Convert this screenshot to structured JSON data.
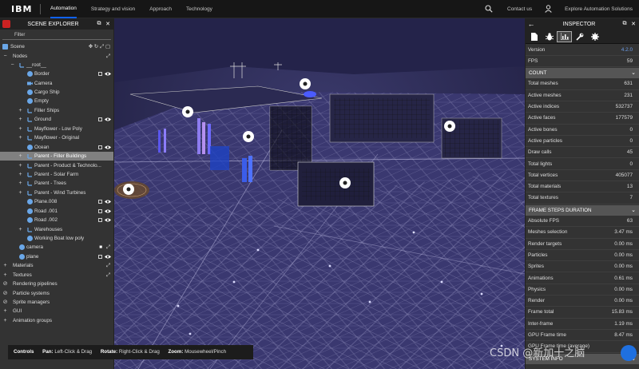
{
  "topnav": {
    "logo": "IBM",
    "links": [
      "Automation",
      "Strategy and vision",
      "Approach",
      "Technology"
    ],
    "active_link": "Automation",
    "contact": "Contact us",
    "solutions": "Explore Automation Solutions"
  },
  "explorer": {
    "title": "SCENE EXPLORER",
    "filter_placeholder": "Filter",
    "scene_label": "Scene",
    "nodes_label": "Nodes",
    "root_label": "__root__",
    "items": [
      {
        "label": "Border",
        "toggle": "",
        "box": true,
        "eye": true
      },
      {
        "label": "Camera",
        "toggle": "",
        "box": false,
        "eye": false
      },
      {
        "label": "Cargo Ship",
        "toggle": "",
        "box": false,
        "eye": false
      },
      {
        "label": "Empty",
        "toggle": "",
        "box": false,
        "eye": false
      },
      {
        "label": "Filler Ships",
        "toggle": "+",
        "box": false,
        "eye": false
      },
      {
        "label": "Ground",
        "toggle": "+",
        "box": true,
        "eye": true
      },
      {
        "label": "Mayflower - Low Poly",
        "toggle": "+",
        "box": false,
        "eye": false
      },
      {
        "label": "Mayflower - Original",
        "toggle": "+",
        "box": false,
        "eye": false
      },
      {
        "label": "Ocean",
        "toggle": "",
        "box": true,
        "eye": true
      },
      {
        "label": "Parent - Filler Buildings",
        "toggle": "+",
        "box": false,
        "eye": false,
        "selected": true
      },
      {
        "label": "Parent - Product & Technolo...",
        "toggle": "+",
        "box": false,
        "eye": false
      },
      {
        "label": "Parent - Solar Farm",
        "toggle": "+",
        "box": false,
        "eye": false
      },
      {
        "label": "Parent - Trees",
        "toggle": "+",
        "box": false,
        "eye": false
      },
      {
        "label": "Parent - Wind Turbines",
        "toggle": "+",
        "box": false,
        "eye": false
      },
      {
        "label": "Plane.008",
        "toggle": "",
        "box": true,
        "eye": true
      },
      {
        "label": "Road .001",
        "toggle": "",
        "box": true,
        "eye": true
      },
      {
        "label": "Road .002",
        "toggle": "",
        "box": true,
        "eye": true
      },
      {
        "label": "Warehouses",
        "toggle": "+",
        "box": false,
        "eye": false
      },
      {
        "label": "Working Boat low poly",
        "toggle": "",
        "box": false,
        "eye": false
      }
    ],
    "camera_label": "camera",
    "plane_label": "plane",
    "sections": [
      "Materials",
      "Textures",
      "Rendering pipelines",
      "Particle systems",
      "Sprite managers",
      "GUI",
      "Animation groups"
    ]
  },
  "controls": {
    "label": "Controls",
    "pan_key": "Pan:",
    "pan_val": "Left-Click & Drag",
    "rotate_key": "Rotate:",
    "rotate_val": "Right-Click & Drag",
    "zoom_key": "Zoom:",
    "zoom_val": "Mousewheel/Pinch"
  },
  "inspector": {
    "title": "INSPECTOR",
    "version_label": "Version",
    "version_value": "4.2.0",
    "fps_label": "FPS",
    "fps_value": "59",
    "count_title": "COUNT",
    "count_rows": [
      {
        "k": "Total meshes",
        "v": "631"
      },
      {
        "k": "Active meshes",
        "v": "231"
      },
      {
        "k": "Active indices",
        "v": "532737"
      },
      {
        "k": "Active faces",
        "v": "177579"
      },
      {
        "k": "Active bones",
        "v": "0"
      },
      {
        "k": "Active particles",
        "v": "0"
      },
      {
        "k": "Draw calls",
        "v": "45"
      },
      {
        "k": "Total lights",
        "v": "0"
      },
      {
        "k": "Total vertices",
        "v": "405077"
      },
      {
        "k": "Total materials",
        "v": "13"
      },
      {
        "k": "Total textures",
        "v": "7"
      }
    ],
    "frame_title": "FRAME STEPS DURATION",
    "frame_rows": [
      {
        "k": "Absolute FPS",
        "v": "63"
      },
      {
        "k": "Meshes selection",
        "v": "3.47 ms"
      },
      {
        "k": "Render targets",
        "v": "0.00 ms"
      },
      {
        "k": "Particles",
        "v": "0.00 ms"
      },
      {
        "k": "Sprites",
        "v": "0.00 ms"
      },
      {
        "k": "Animations",
        "v": "0.61 ms"
      },
      {
        "k": "Physics",
        "v": "0.00 ms"
      },
      {
        "k": "Render",
        "v": "0.00 ms"
      },
      {
        "k": "Frame total",
        "v": "15.83 ms"
      },
      {
        "k": "Inter-frame",
        "v": "1.19 ms"
      },
      {
        "k": "GPU Frame time",
        "v": "8.47 ms"
      },
      {
        "k": "GPU Frame time (average)",
        "v": ""
      }
    ],
    "system_title": "SYSTEM INFO"
  },
  "watermark": "CSDN @新加十之脑",
  "colors": {
    "accent_blue": "#0f62fe",
    "version_blue": "#6c9eea",
    "selected_row": "#808080",
    "panel_bg": "#333333"
  }
}
